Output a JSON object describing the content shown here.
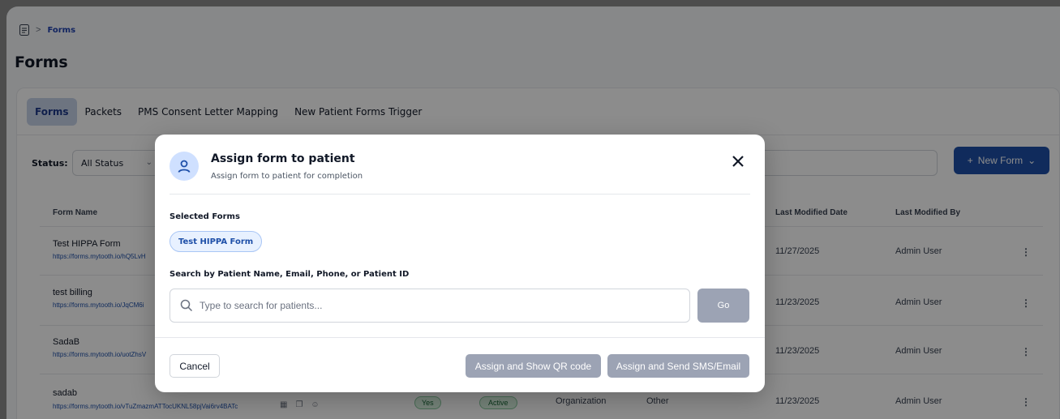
{
  "breadcrumb": {
    "current": "Forms"
  },
  "page_title": "Forms",
  "tabs": [
    {
      "label": "Forms",
      "active": true
    },
    {
      "label": "Packets",
      "active": false
    },
    {
      "label": "PMS Consent Letter Mapping",
      "active": false
    },
    {
      "label": "New Patient Forms Trigger",
      "active": false
    }
  ],
  "filters": {
    "status_label": "Status:",
    "status_value": "All Status"
  },
  "toolbar": {
    "new_form_label": "New Form"
  },
  "table": {
    "headers": {
      "form_name": "Form Name",
      "last_modified_date": "Last Modified Date",
      "last_modified_by": "Last Modified By"
    },
    "rows": [
      {
        "name": "Test HIPPA Form",
        "url": "https://forms.mytooth.io/hQ5LvH",
        "date": "11/27/2025",
        "by": "Admin User"
      },
      {
        "name": "test billing",
        "url": "https://forms.mytooth.io/JqCM6i",
        "date": "11/23/2025",
        "by": "Admin User"
      },
      {
        "name": "SadaB",
        "url": "https://forms.mytooth.io/uotZhsV",
        "date": "11/23/2025",
        "by": "Admin User"
      },
      {
        "name": "sadab",
        "url": "https://forms.mytooth.io/vTuZmazmATTocUKNL58pjVai6rv4BATc",
        "date": "11/23/2025",
        "by": "Admin User",
        "required": "Yes",
        "status": "Active",
        "type": "Organization",
        "category": "Other"
      }
    ]
  },
  "modal": {
    "title": "Assign form to patient",
    "subtitle": "Assign form to patient for completion",
    "selected_label": "Selected Forms",
    "selected_chip": "Test HIPPA Form",
    "search_label": "Search by Patient Name, Email, Phone, or Patient ID",
    "search_placeholder": "Type to search for patients...",
    "go_label": "Go",
    "cancel_label": "Cancel",
    "qr_label": "Assign and Show QR code",
    "sms_label": "Assign and Send SMS/Email",
    "accent": "#1e4fa8"
  }
}
